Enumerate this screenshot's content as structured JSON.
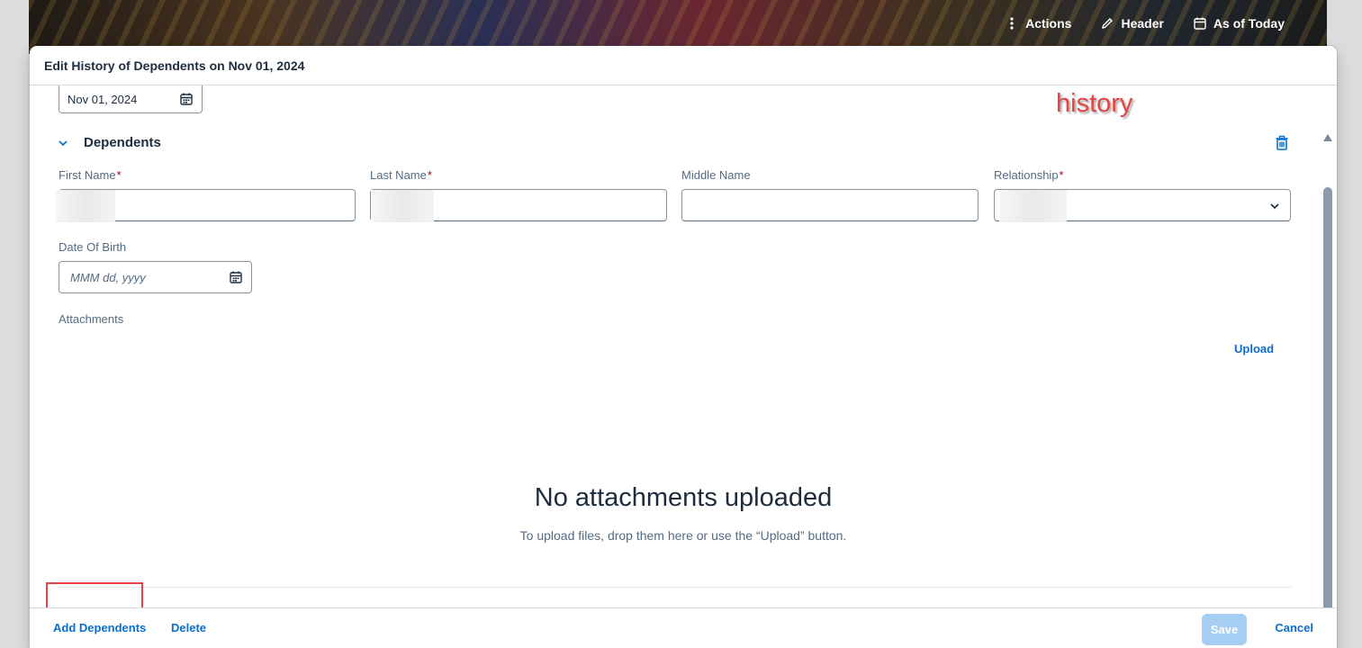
{
  "background_header": {
    "actions": [
      {
        "label": "Actions",
        "icon": "more-vertical-icon"
      },
      {
        "label": "Header",
        "icon": "pencil-icon"
      },
      {
        "label": "As of Today",
        "icon": "calendar-icon"
      }
    ]
  },
  "dialog": {
    "title": "Edit History of Dependents on Nov 01, 2024",
    "effective_date": {
      "value": "Nov 01, 2024",
      "icon": "calendar-icon"
    },
    "annotation": "history",
    "section": {
      "title": "Dependents",
      "delete_icon": "trash-icon",
      "fields": {
        "first_name": {
          "label": "First Name",
          "required_mark": "*"
        },
        "last_name": {
          "label": "Last Name",
          "required_mark": "*"
        },
        "middle_name": {
          "label": "Middle Name",
          "value": ""
        },
        "relationship": {
          "label": "Relationship",
          "required_mark": "*"
        },
        "date_of_birth": {
          "label": "Date Of Birth",
          "placeholder": "MMM dd, yyyy"
        }
      },
      "attachments": {
        "label": "Attachments",
        "upload_label": "Upload",
        "empty_title": "No attachments uploaded",
        "empty_subtitle": "To upload files, drop them here or use the “Upload” button."
      }
    },
    "footer": {
      "add_label": "Add Dependents",
      "delete_label": "Delete",
      "save_label": "Save",
      "cancel_label": "Cancel"
    }
  },
  "colors": {
    "accent": "#0a6ed1",
    "required": "#aa0808",
    "annotation": "#e24545",
    "save_disabled": "#a6cdf2"
  }
}
